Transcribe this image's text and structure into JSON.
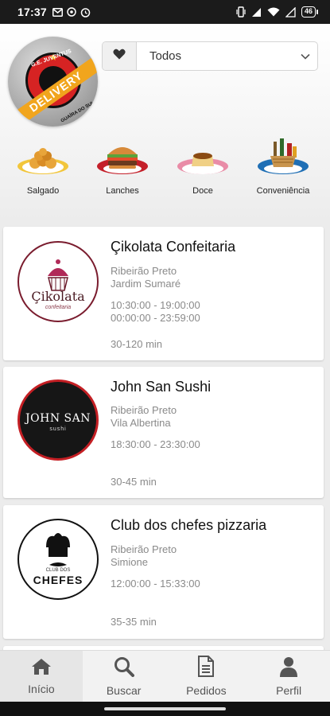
{
  "status_bar": {
    "time": "17:37",
    "battery": "46"
  },
  "brand": {
    "logo_band_text": "DELIVERY",
    "logo_top_text": "G.E. JUVENTUS",
    "logo_bottom_text": "GUAÍRA DO SUL"
  },
  "filter": {
    "selected": "Todos",
    "heart_icon": "heart-icon",
    "chevron_icon": "chevron-down-icon"
  },
  "categories": [
    {
      "label": "Salgado",
      "icon": "savory-snacks-icon"
    },
    {
      "label": "Lanches",
      "icon": "burger-icon"
    },
    {
      "label": "Doce",
      "icon": "pudding-icon"
    },
    {
      "label": "Conveniência",
      "icon": "convenience-basket-icon"
    }
  ],
  "stores": [
    {
      "name": "Çikolata Confeitaria",
      "logo_text": "Çikolata",
      "logo_sub": "confeitaria",
      "city": "Ribeirão Preto",
      "district": "Jardim Sumaré",
      "hours": [
        "10:30:00 - 19:00:00",
        "00:00:00 - 23:59:00"
      ],
      "delivery_time": "30-120 min"
    },
    {
      "name": "John San Sushi",
      "logo_text": "JOHN SAN",
      "logo_sub": "sushi",
      "city": "Ribeirão Preto",
      "district": "Vila Albertina",
      "hours": [
        "18:30:00 - 23:30:00"
      ],
      "delivery_time": "30-45 min"
    },
    {
      "name": "Club dos chefes pizzaria",
      "logo_text": "CHEFES",
      "logo_sub": "CLUB DOS",
      "city": "Ribeirão Preto",
      "district": "Simione",
      "hours": [
        "12:00:00 - 15:33:00"
      ],
      "delivery_time": "35-35 min"
    }
  ],
  "tabs": [
    {
      "label": "Início",
      "icon": "home-icon",
      "active": true
    },
    {
      "label": "Buscar",
      "icon": "search-icon",
      "active": false
    },
    {
      "label": "Pedidos",
      "icon": "document-icon",
      "active": false
    },
    {
      "label": "Perfil",
      "icon": "user-icon",
      "active": false
    }
  ],
  "colors": {
    "brand_red": "#d62323",
    "brand_yellow": "#f1a51d",
    "text_muted": "#8a8a8a"
  }
}
